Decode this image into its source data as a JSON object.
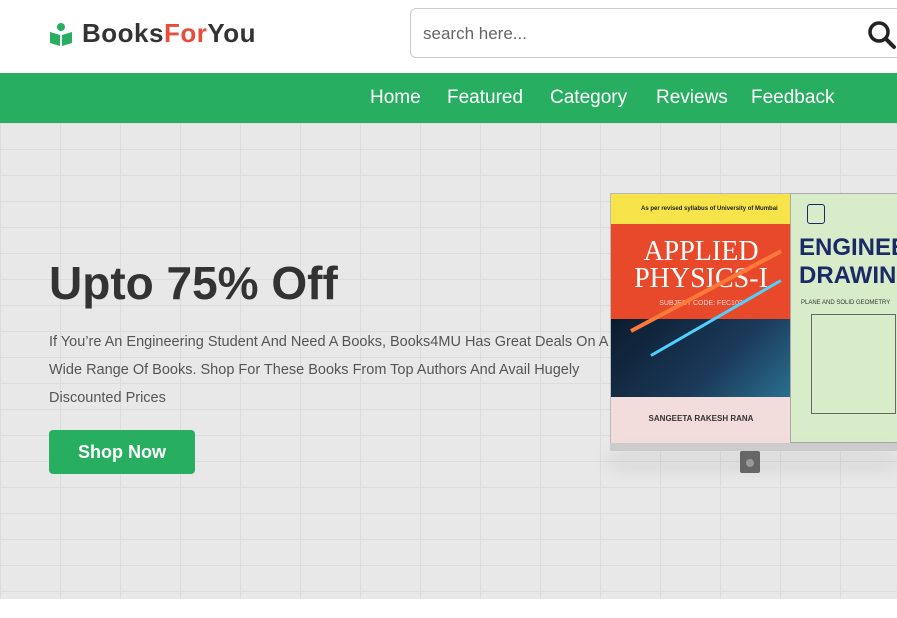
{
  "logo": {
    "part1": "Books",
    "part2": "For",
    "part3": "You"
  },
  "search": {
    "placeholder": "search here..."
  },
  "nav": {
    "items": [
      {
        "label": "Home"
      },
      {
        "label": "Featured"
      },
      {
        "label": "Category"
      },
      {
        "label": "Reviews"
      },
      {
        "label": "Feedback"
      }
    ]
  },
  "hero": {
    "title": "Upto 75% Off",
    "description": "If You’re An Engineering Student And Need A Books, Books4MU Has Great Deals On A Wide Range Of Books. Shop For These Books From Top Authors And Avail Hugely Discounted Prices",
    "button": "Shop Now"
  },
  "books": {
    "book1": {
      "tagline": "As per revised syllabus of University of Mumbai",
      "title1": "APPLIED",
      "title2": "PHYSICS-I",
      "code": "SUBJECT CODE: FEC102",
      "author": "SANGEETA RAKESH RANA"
    },
    "book2": {
      "title1": "ENGINEE",
      "title2": "DRAWING",
      "subtitle": "PLANE AND SOLID GEOMETRY"
    }
  },
  "colors": {
    "accent": "#27ae60",
    "logo_for": "#e74c3c"
  },
  "icons": {
    "search": "search-icon",
    "logo": "book-reader-icon"
  }
}
